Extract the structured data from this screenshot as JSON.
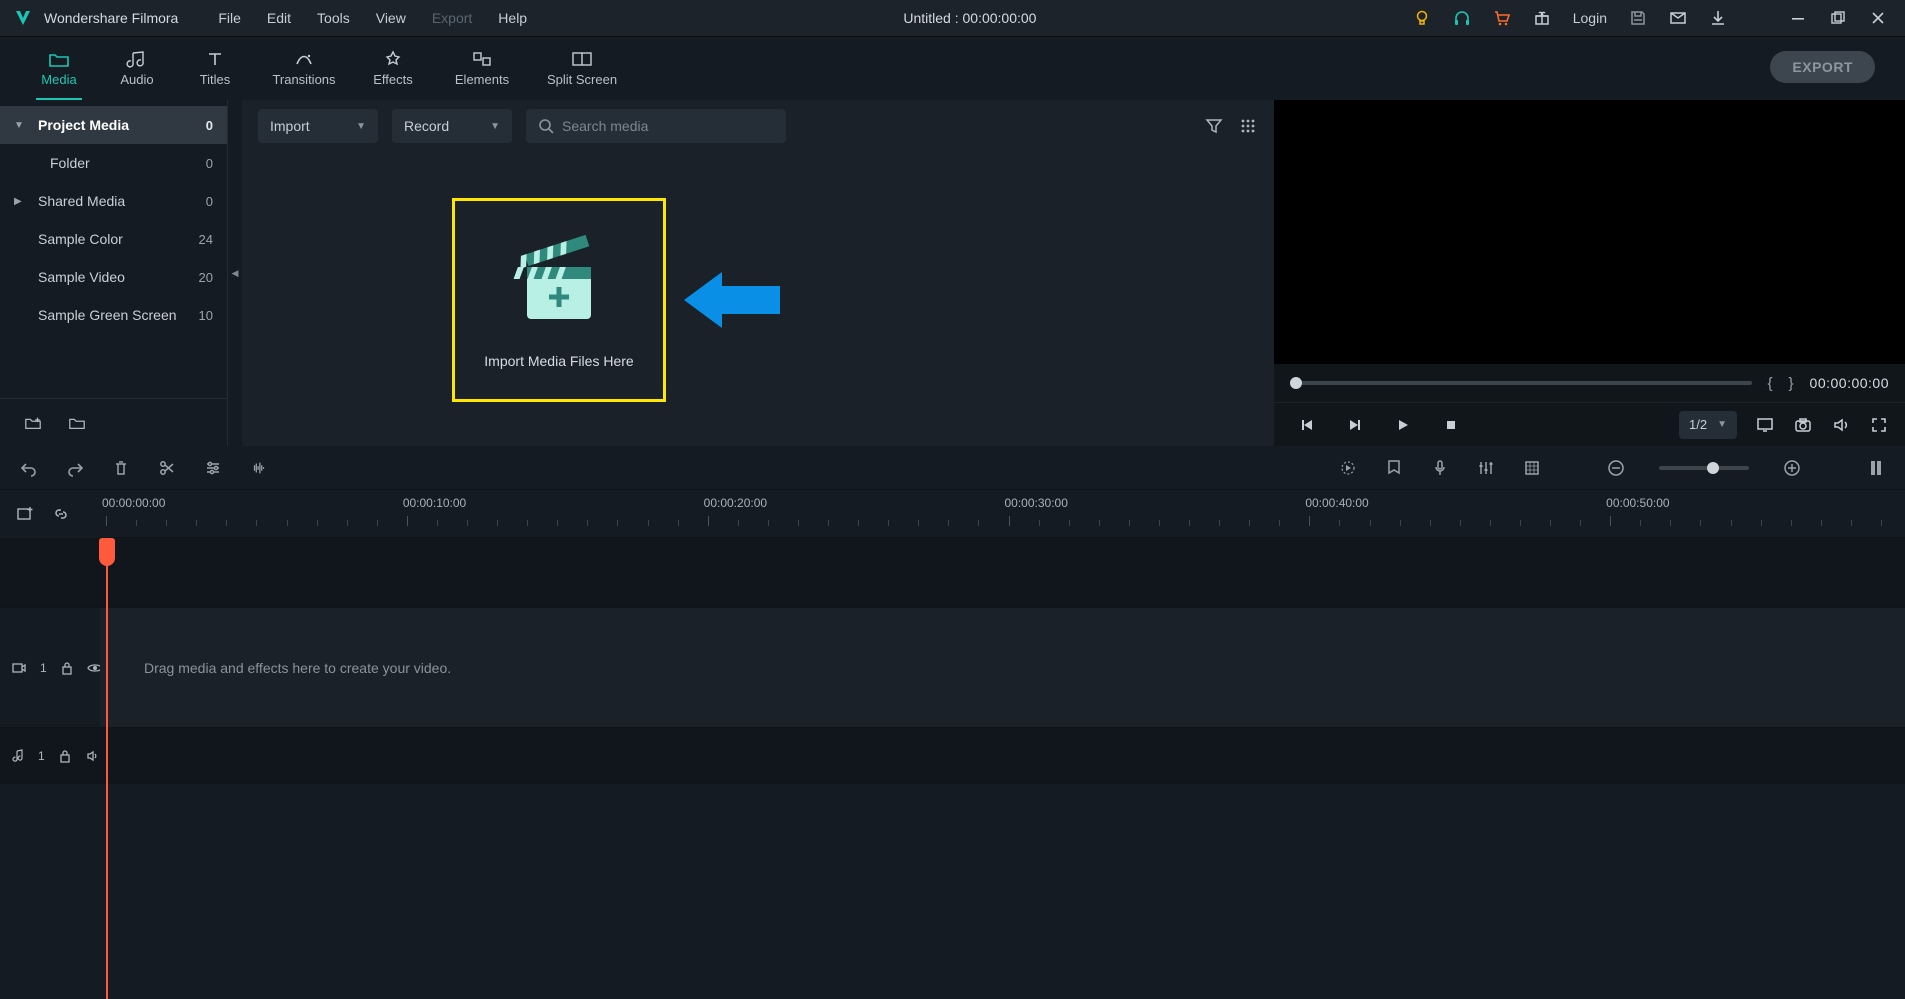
{
  "app": {
    "name": "Wondershare Filmora"
  },
  "menubar": {
    "file": "File",
    "edit": "Edit",
    "tools": "Tools",
    "view": "View",
    "export": "Export",
    "help": "Help"
  },
  "title": "Untitled : 00:00:00:00",
  "topright": {
    "login": "Login"
  },
  "tabs": {
    "media": "Media",
    "audio": "Audio",
    "titles": "Titles",
    "transitions": "Transitions",
    "effects": "Effects",
    "elements": "Elements",
    "splitscreen": "Split Screen",
    "export": "EXPORT"
  },
  "sidebar": {
    "items": [
      {
        "label": "Project Media",
        "count": "0"
      },
      {
        "label": "Folder",
        "count": "0"
      },
      {
        "label": "Shared Media",
        "count": "0"
      },
      {
        "label": "Sample Color",
        "count": "24"
      },
      {
        "label": "Sample Video",
        "count": "20"
      },
      {
        "label": "Sample Green Screen",
        "count": "10"
      }
    ]
  },
  "mediapane": {
    "import": "Import",
    "record": "Record",
    "search_placeholder": "Search media",
    "import_caption": "Import Media Files Here"
  },
  "preview": {
    "brace_open": "{",
    "brace_close": "}",
    "timecode": "00:00:00:00",
    "speed": "1/2"
  },
  "timeline": {
    "labels": [
      "00:00:00:00",
      "00:00:10:00",
      "00:00:20:00",
      "00:00:30:00",
      "00:00:40:00",
      "00:00:50:00"
    ],
    "video_track": "1",
    "audio_track": "1",
    "hint": "Drag media and effects here to create your video."
  }
}
